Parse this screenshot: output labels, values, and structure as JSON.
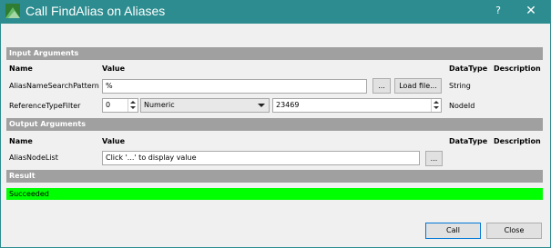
{
  "window": {
    "title": "Call FindAlias on Aliases",
    "help_glyph": "?",
    "close_glyph": "✕"
  },
  "sections": {
    "input": "Input Arguments",
    "output": "Output Arguments",
    "result": "Result"
  },
  "columns": {
    "name": "Name",
    "value": "Value",
    "datatype": "DataType",
    "description": "Description"
  },
  "input_args": {
    "alias": {
      "name": "AliasNameSearchPattern",
      "value": "%",
      "browse_label": "...",
      "load_label": "Load file...",
      "datatype": "String"
    },
    "reftype": {
      "name": "ReferenceTypeFilter",
      "namespace": "0",
      "idtype": "Numeric",
      "id": "23469",
      "datatype": "NodeId"
    }
  },
  "output_args": {
    "nodelist": {
      "name": "AliasNodeList",
      "value": "Click '...' to display value",
      "browse_label": "..."
    }
  },
  "result": {
    "status": "Succeeded",
    "status_color": "#00ff00"
  },
  "buttons": {
    "call": "Call",
    "close": "Close"
  },
  "colors": {
    "titlebar": "#2c8c8f",
    "section": "#a0a0a0"
  }
}
